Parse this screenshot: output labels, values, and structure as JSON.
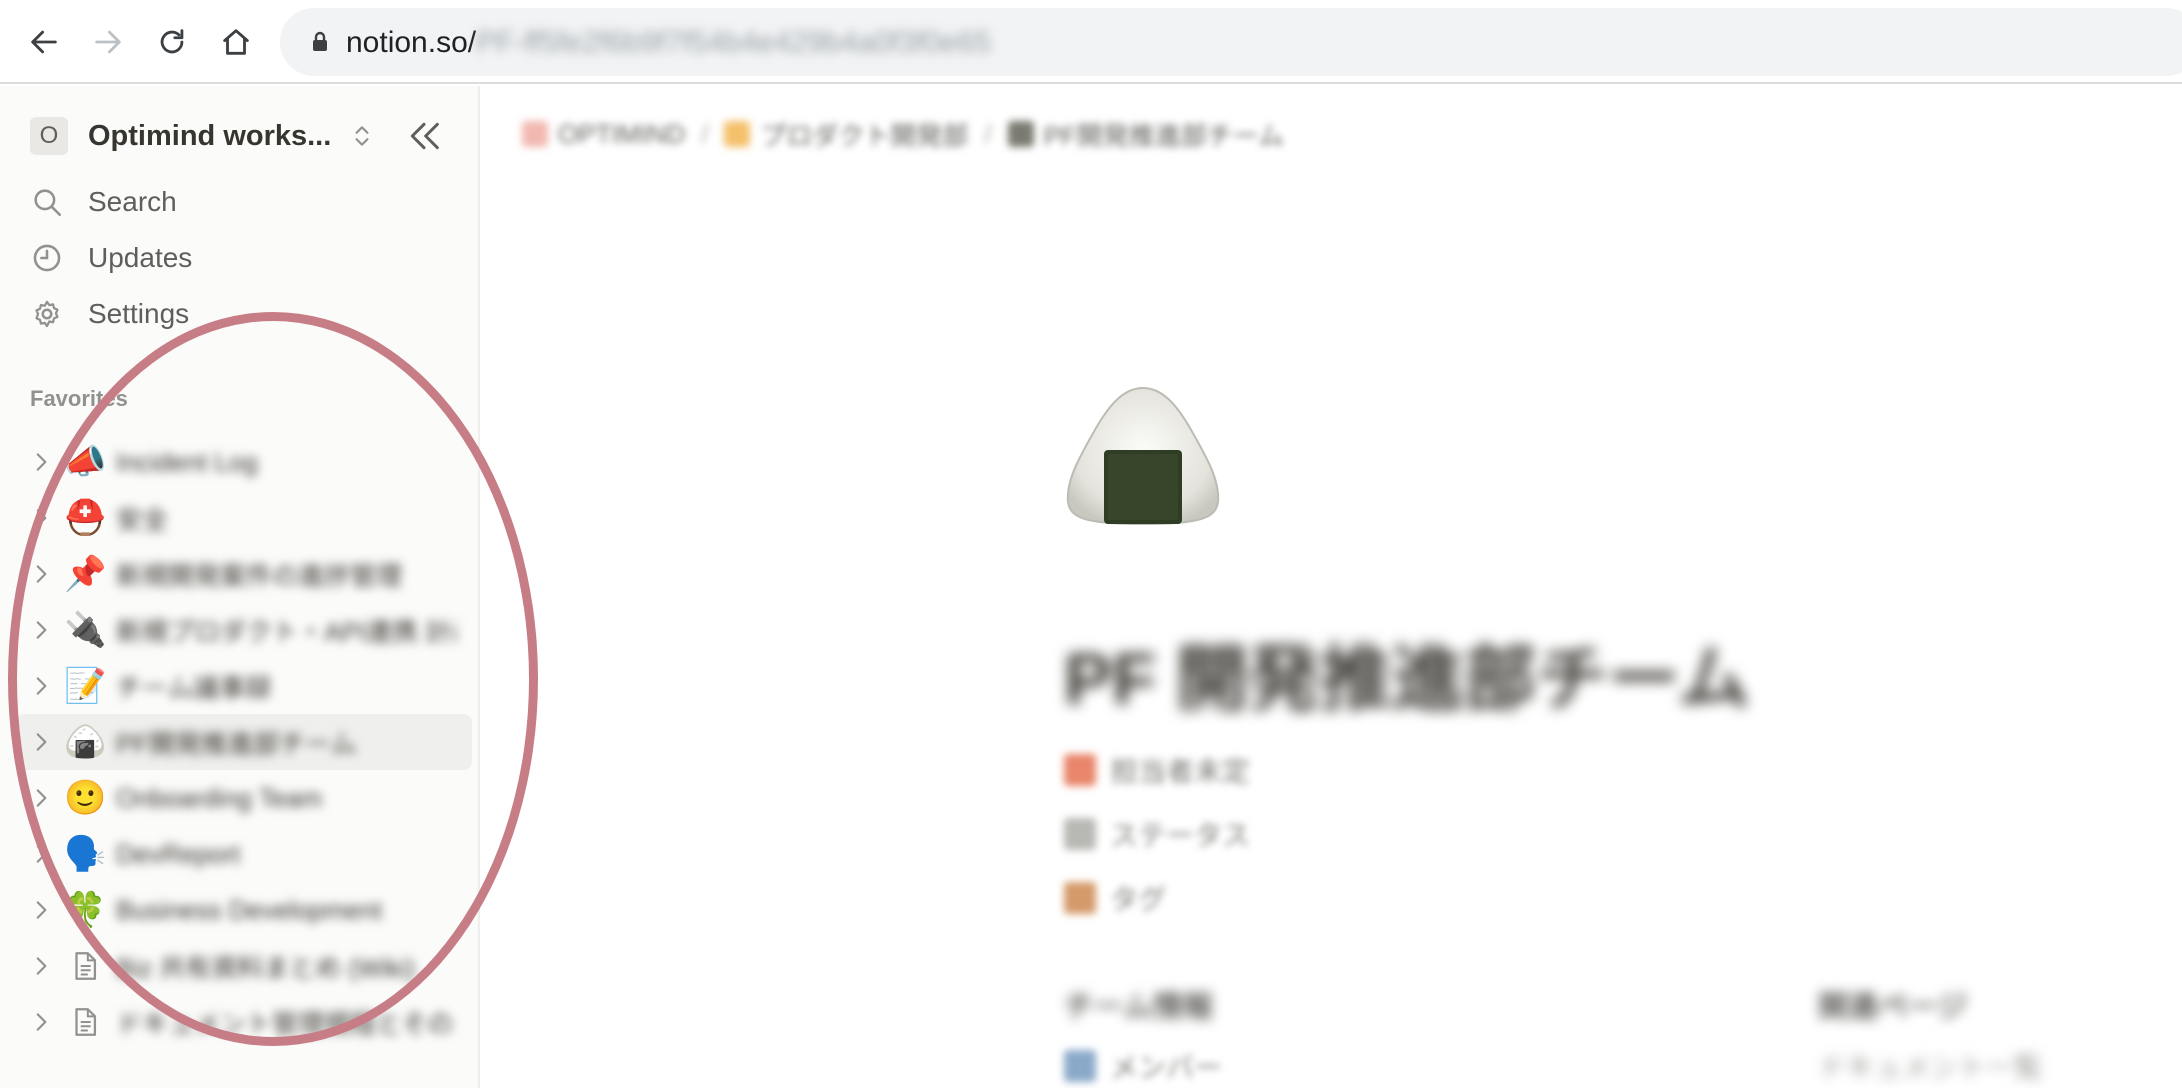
{
  "browser": {
    "url_host": "notion.so/",
    "url_path": "PF-ff5fe2f6b9f7f54b4e429b4a0f3f0e65"
  },
  "sidebar": {
    "workspace_initial": "O",
    "workspace_name": "Optimind works...",
    "menu": [
      {
        "label": "Search",
        "icon": "search-icon"
      },
      {
        "label": "Updates",
        "icon": "clock-icon"
      },
      {
        "label": "Settings",
        "icon": "gear-icon"
      }
    ],
    "favorites_heading": "Favorites",
    "favorites": [
      {
        "emoji": "📣",
        "label": "Incident Log"
      },
      {
        "emoji": "⛑️",
        "label": "安全"
      },
      {
        "emoji": "📌",
        "label": "新規開発案件の進捗管理"
      },
      {
        "emoji": "🔌",
        "label": "新規プロダクト・API連携 計画..."
      },
      {
        "emoji": "📝",
        "label": "チーム議事録"
      },
      {
        "emoji": "🍙",
        "label": "PF開発推進部チーム",
        "active": true
      },
      {
        "emoji": "🙂",
        "label": "Onboarding Team"
      },
      {
        "emoji": "🗣️",
        "label": "DevReport"
      },
      {
        "emoji": "🍀",
        "label": "Business Development"
      },
      {
        "emoji": "",
        "icon": "page-icon",
        "label": "Biz 共有資料まとめ (Wiki)"
      },
      {
        "emoji": "",
        "icon": "page-icon",
        "label": "ドキュメント管理規程とその..."
      }
    ]
  },
  "main": {
    "breadcrumbs": [
      {
        "label": "OPTIMIND",
        "color": "#f2b8b0"
      },
      {
        "label": "プロダクト開発部",
        "color": "#f4c06a"
      },
      {
        "label": "PF開発推進部チーム",
        "color": "#7a7a70"
      }
    ],
    "page_emoji": "onigiri",
    "title": "PF 開発推進部チーム",
    "properties": [
      {
        "value": "担当者未定",
        "color": "#e8856a"
      },
      {
        "value": "ステータス",
        "color": "#b8b8b4"
      },
      {
        "value": "タグ",
        "color": "#d49a6a"
      }
    ],
    "section_left": "チーム情報",
    "section_left_value": "メンバー",
    "section_right": "関連ページ",
    "section_right_value": "ドキュメント一覧"
  }
}
